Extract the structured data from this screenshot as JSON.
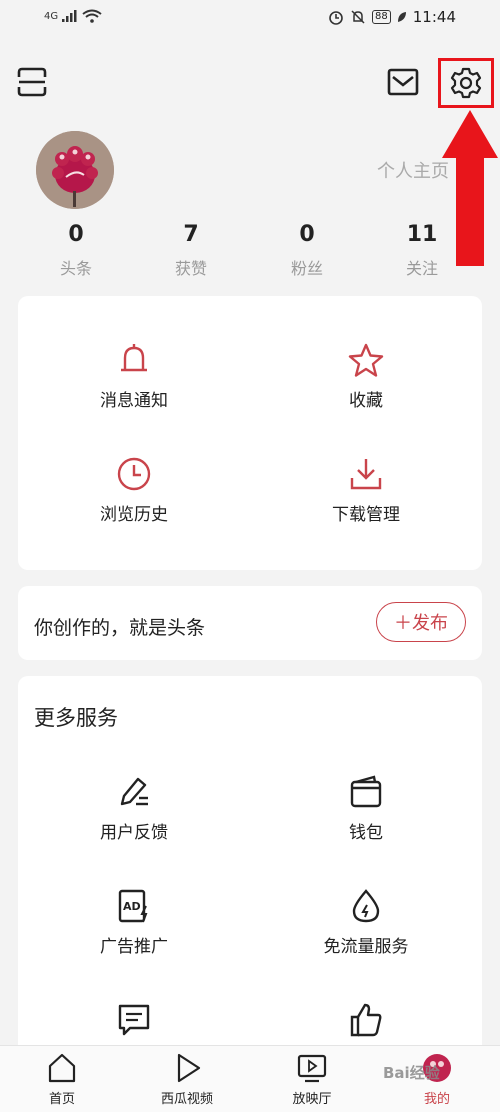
{
  "status_bar": {
    "network": "4G",
    "battery": "88",
    "time": "11:44"
  },
  "header": {
    "profile_link": "个人主页"
  },
  "stats": [
    {
      "value": "0",
      "label": "头条"
    },
    {
      "value": "7",
      "label": "获赞"
    },
    {
      "value": "0",
      "label": "粉丝"
    },
    {
      "value": "11",
      "label": "关注"
    }
  ],
  "quick_menu": [
    {
      "label": "消息通知",
      "icon": "bell-icon"
    },
    {
      "label": "收藏",
      "icon": "star-icon"
    },
    {
      "label": "浏览历史",
      "icon": "clock-icon"
    },
    {
      "label": "下载管理",
      "icon": "download-icon"
    }
  ],
  "create": {
    "text": "你创作的，就是头条",
    "publish_label": "＋发布"
  },
  "more_services": {
    "title": "更多服务",
    "items": [
      {
        "label": "用户反馈",
        "icon": "pen-icon"
      },
      {
        "label": "钱包",
        "icon": "wallet-icon"
      },
      {
        "label": "广告推广",
        "icon": "ad-icon"
      },
      {
        "label": "免流量服务",
        "icon": "drop-icon"
      }
    ]
  },
  "tabbar": [
    {
      "label": "首页",
      "icon": "home-icon"
    },
    {
      "label": "西瓜视频",
      "icon": "play-icon"
    },
    {
      "label": "放映厅",
      "icon": "tv-icon"
    },
    {
      "label": "我的",
      "icon": "avatar-icon"
    }
  ],
  "colors": {
    "accent": "#c9444b",
    "annotation": "#e8151b",
    "background": "#f3f3f3"
  },
  "watermark": "Bai经验"
}
